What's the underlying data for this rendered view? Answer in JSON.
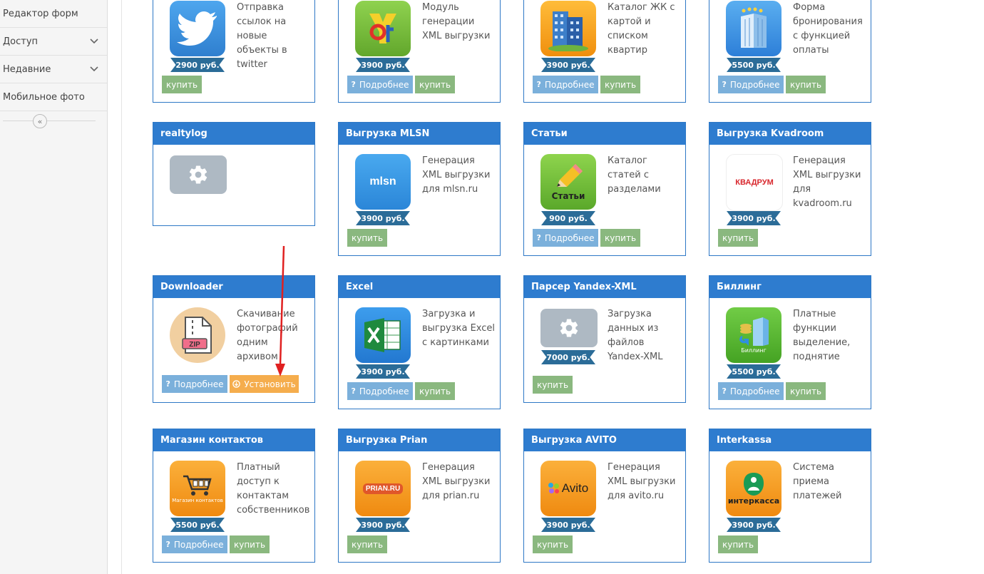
{
  "sidebar": {
    "items": [
      {
        "label": "Редактор форм"
      },
      {
        "label": "Доступ"
      },
      {
        "label": "Недавние"
      },
      {
        "label": "Мобильное фото"
      }
    ]
  },
  "modules": [
    {
      "title": "",
      "desc": "Отправка ссылок на новые объекты в twitter",
      "price": "2900 руб.",
      "icon": "twitter-bird-icon",
      "color": "#3c8edb"
    },
    {
      "title": "",
      "desc": "Модуль генерации XML выгрузки",
      "price": "3900 руб.",
      "icon": "xml-module-icon",
      "color": "#7cc242"
    },
    {
      "title": "",
      "desc": "Каталог ЖК с картой и списком квартир",
      "price": "3900 руб.",
      "icon": "building-icon",
      "color": "#f5a31a"
    },
    {
      "title": "",
      "desc": "Форма бронирования с функцией оплаты",
      "price": "5500 руб.",
      "icon": "hotel-icon",
      "color": "#3a8fe0"
    },
    {
      "title": "realtylog",
      "desc": "",
      "price": "",
      "icon": "gear-icon",
      "color": "#aeb9c3"
    },
    {
      "title": "Выгрузка MLSN",
      "desc": "Генерация XML выгрузки для mlsn.ru",
      "price": "3900 руб.",
      "icon": "mlsn-logo-icon",
      "color": "#3a9ce8",
      "logo": "mlsn"
    },
    {
      "title": "Статьи",
      "desc": "Каталог статей с разделами",
      "price": "900 руб.",
      "icon": "pencil-icon",
      "color": "#7cc242",
      "logo": "Статьи"
    },
    {
      "title": "Выгрузка Kvadroom",
      "desc": "Генерация XML выгрузки для kvadroom.ru",
      "price": "3900 руб.",
      "icon": "kvadroom-logo-icon",
      "color": "#ffffff",
      "logo": "КВАДРУМ"
    },
    {
      "title": "Downloader",
      "desc": "Скачивание фотографий одним архивом",
      "price": "",
      "icon": "zip-file-icon",
      "color": "#f1cfa0"
    },
    {
      "title": "Excel",
      "desc": "Загрузка и выгрузка Excel с картинками",
      "price": "3900 руб.",
      "icon": "excel-icon",
      "color": "#2a8be0"
    },
    {
      "title": "Парсер Yandex-XML",
      "desc": "Загрузка данных из файлов Yandex-XML",
      "price": "7000 руб.",
      "icon": "gear-icon",
      "color": "#aeb9c3"
    },
    {
      "title": "Биллинг",
      "desc": "Платные функции выделение, поднятие",
      "price": "5500 руб.",
      "icon": "billing-icon",
      "color": "#5cbd33",
      "logo": "Биллинг"
    },
    {
      "title": "Магазин контактов",
      "desc": "Платный доступ к контактам собственников",
      "price": "5500 руб.",
      "icon": "cart-icon",
      "color": "#f39c12",
      "logo": "Магазин контактов"
    },
    {
      "title": "Выгрузка Prian",
      "desc": "Генерация XML выгрузки для prian.ru",
      "price": "3900 руб.",
      "icon": "prian-logo-icon",
      "color": "#f39c12",
      "logo": "PRIAN.RU"
    },
    {
      "title": "Выгрузка AVITO",
      "desc": "Генерация XML выгрузки для avito.ru",
      "price": "3900 руб.",
      "icon": "avito-logo-icon",
      "color": "#f39c12",
      "logo": "Avito"
    },
    {
      "title": "Interkassa",
      "desc": "Система приема платежей",
      "price": "3900 руб.",
      "icon": "interkassa-logo-icon",
      "color": "#f5a31a",
      "logo": "интеркасса"
    }
  ],
  "buttons": {
    "details": "Подробнее",
    "buy": "купить",
    "install": "Установить"
  },
  "colors": {
    "header": "#2e7ccf",
    "buy": "#8ab87f",
    "details": "#7bb0db",
    "install": "#f5ad4d",
    "price_tag": "#2b6c98",
    "annotation_arrow": "#e02020"
  }
}
